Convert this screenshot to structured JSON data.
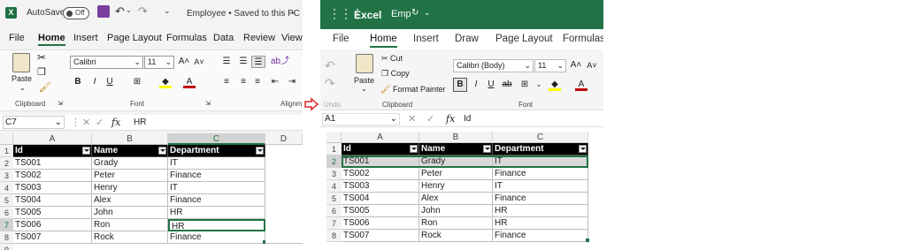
{
  "left": {
    "autosave_label": "AutoSave",
    "autosave_state": "Off",
    "doc_title": "Employee • Saved to this PC",
    "tabs": [
      "File",
      "Home",
      "Insert",
      "Page Layout",
      "Formulas",
      "Data",
      "Review",
      "View"
    ],
    "font_name": "Calibri",
    "font_size": "11",
    "paste_label": "Paste",
    "groups": {
      "clipboard": "Clipboard",
      "font": "Font",
      "alignment": "Alignm"
    },
    "name_box": "C7",
    "formula_value": "HR",
    "fx": "fx",
    "columns": [
      "A",
      "B",
      "C",
      "D"
    ],
    "rows": [
      "1",
      "2",
      "3",
      "4",
      "5",
      "6",
      "7",
      "8",
      "9"
    ]
  },
  "right": {
    "app_name": "Excel",
    "doc_name": "Emp",
    "tabs": [
      "File",
      "Home",
      "Insert",
      "Draw",
      "Page Layout",
      "Formulas"
    ],
    "font_name": "Calibri (Body)",
    "font_size": "11",
    "paste_label": "Paste",
    "cut": "Cut",
    "copy": "Copy",
    "format_painter": "Format Painter",
    "groups": {
      "undo": "Undo",
      "clipboard": "Clipboard",
      "font": "Font"
    },
    "name_box": "A1",
    "formula_value": "Id",
    "fx": "fx",
    "columns": [
      "A",
      "B",
      "C"
    ],
    "rows": [
      "1",
      "2",
      "3",
      "4",
      "5",
      "6",
      "7",
      "8"
    ]
  },
  "table": {
    "headers": [
      "Id",
      "Name",
      "Department"
    ],
    "rows": [
      [
        "TS001",
        "Grady",
        "IT"
      ],
      [
        "TS002",
        "Peter",
        "Finance"
      ],
      [
        "TS003",
        "Henry",
        "IT"
      ],
      [
        "TS004",
        "Alex",
        "Finance"
      ],
      [
        "TS005",
        "John",
        "HR"
      ],
      [
        "TS006",
        "Ron",
        "HR"
      ],
      [
        "TS007",
        "Rock",
        "Finance"
      ]
    ]
  },
  "colors": {
    "excel_green": "#217346",
    "arrow_red": "#d9262b",
    "accent_red": "#c00000",
    "highlight_yellow": "#ffff00"
  }
}
